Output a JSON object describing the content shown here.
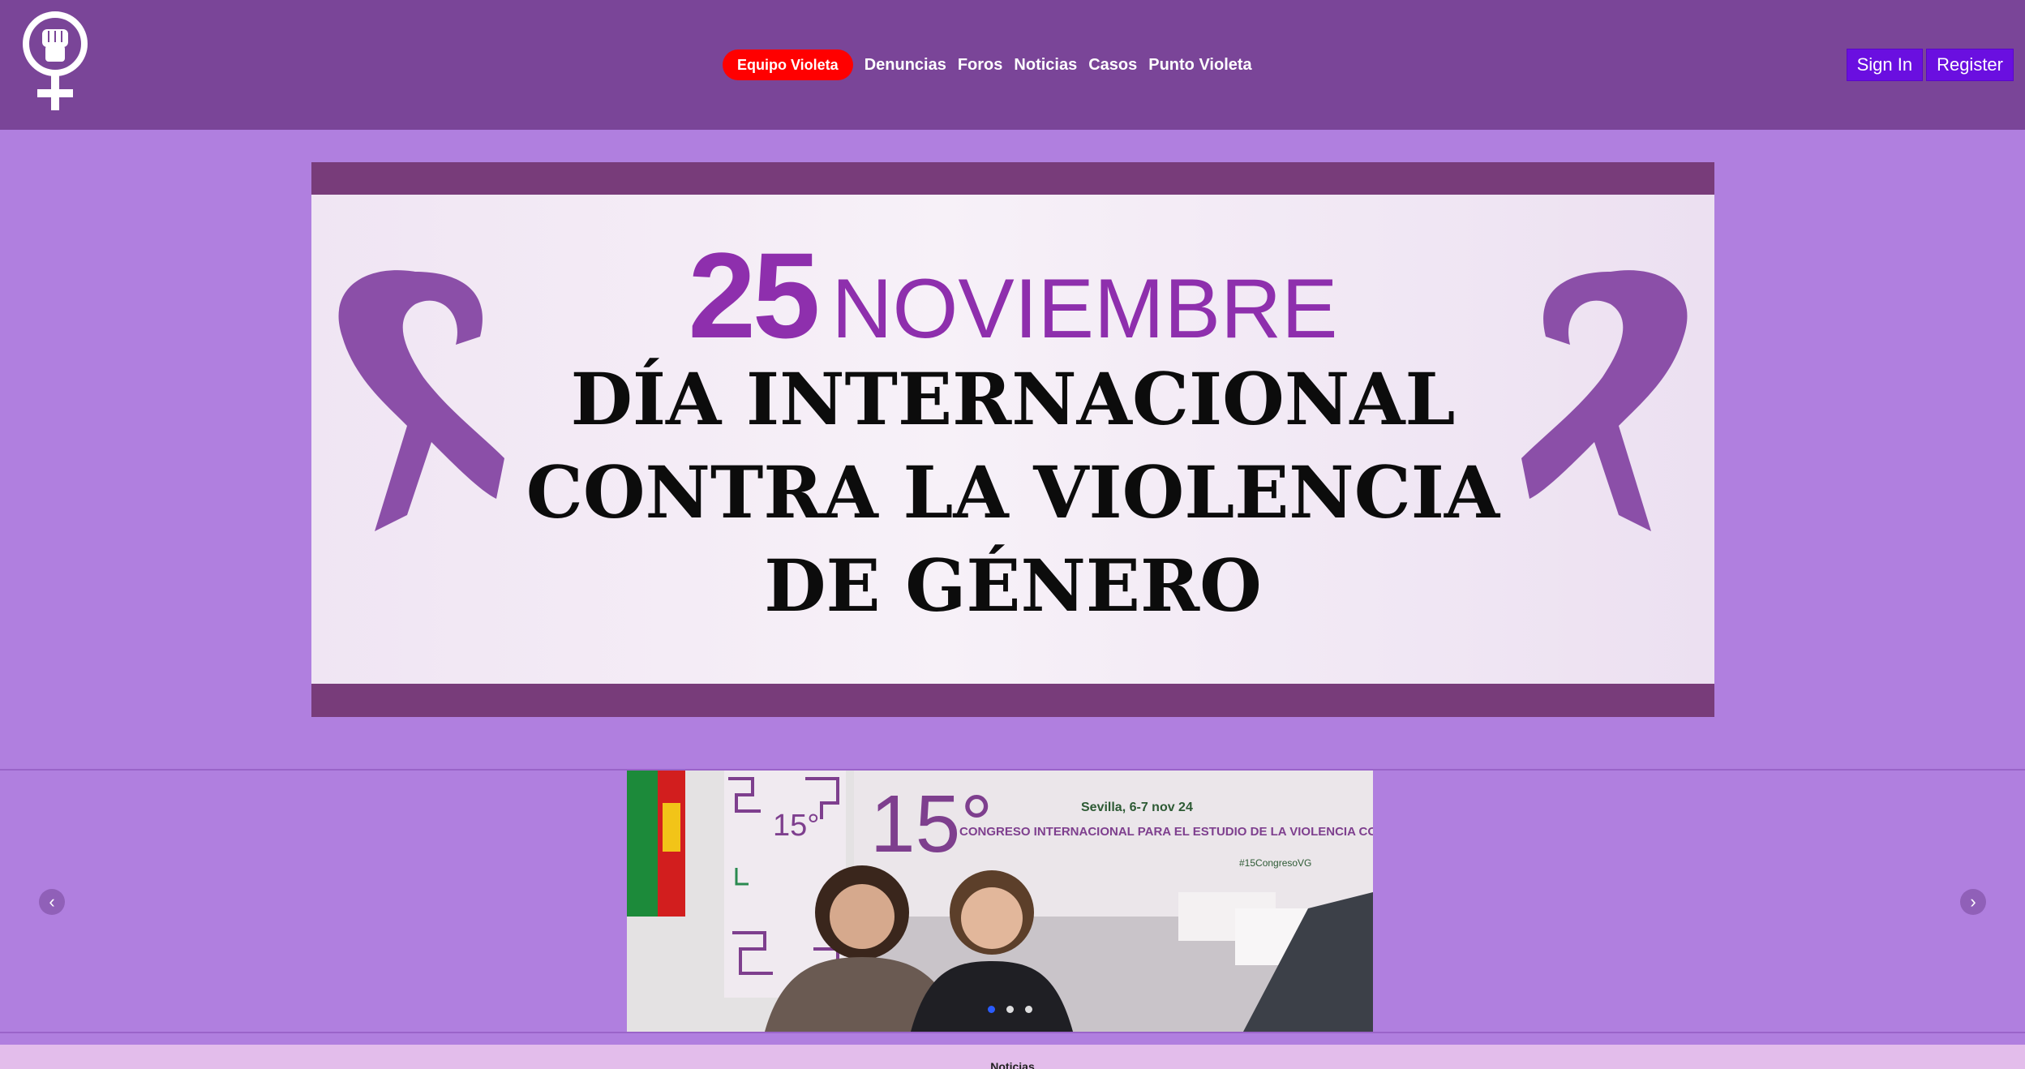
{
  "header": {
    "logo_icon": "female-fist-symbol-icon",
    "nav": {
      "highlight": "Equipo Violeta",
      "links": [
        "Denuncias",
        "Foros",
        "Noticias",
        "Casos",
        "Punto Violeta"
      ]
    },
    "auth": {
      "sign_in": "Sign In",
      "register": "Register"
    }
  },
  "banner": {
    "day": "25",
    "month": "NOVIEMBRE",
    "line1": "DÍA INTERNACIONAL",
    "line2": "CONTRA LA VIOLENCIA",
    "line3": "DE GÉNERO",
    "ribbon_icon": "awareness-ribbon-icon"
  },
  "carousel": {
    "prev": "‹",
    "next": "›",
    "slide": {
      "number": "15°",
      "location_date": "Sevilla, 6-7 nov 24",
      "title": "CONGRESO INTERNACIONAL PARA EL ESTUDIO DE LA VIOLENCIA CONTRA LAS MUJERES",
      "hashtag": "#15CongresoVG"
    },
    "dots": 3,
    "active_dot": 0
  },
  "footer_section": {
    "label": "Noticias"
  },
  "colors": {
    "header_bg": "#7a4598",
    "page_bg": "#b07fdf",
    "highlight_pill": "#ff0000",
    "auth_button": "#6a0fe0",
    "banner_frame": "#783c7a",
    "banner_purple": "#8e2fad"
  }
}
